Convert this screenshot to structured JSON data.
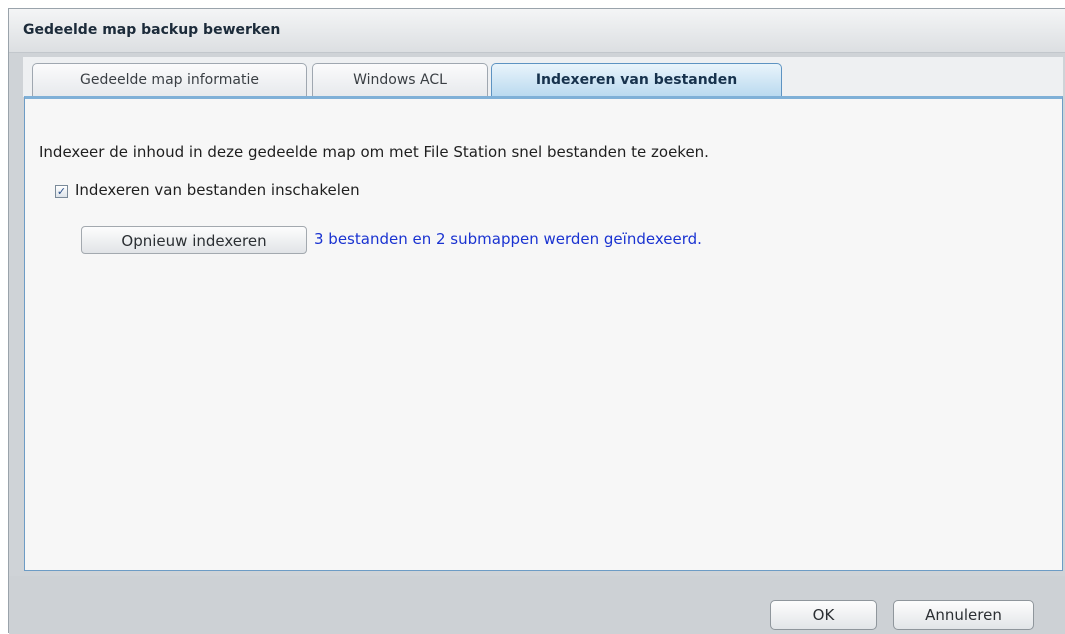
{
  "window": {
    "title": "Gedeelde map backup bewerken"
  },
  "tabs": [
    {
      "label": "Gedeelde map informatie",
      "active": false
    },
    {
      "label": "Windows ACL",
      "active": false
    },
    {
      "label": "Indexeren van bestanden",
      "active": true
    }
  ],
  "panel": {
    "description": "Indexeer de inhoud in deze gedeelde map om met File Station snel bestanden te zoeken.",
    "checkbox": {
      "label": "Indexeren van bestanden inschakelen",
      "checked": true
    },
    "reindex_button_label": "Opnieuw indexeren",
    "status": "3 bestanden en 2 submappen werden geïndexeerd."
  },
  "footer": {
    "ok_label": "OK",
    "cancel_label": "Annuleren"
  },
  "colors": {
    "status_text": "#1a33d1",
    "active_tab": "#b9d9ef",
    "panel_border": "#6d9cc5"
  }
}
